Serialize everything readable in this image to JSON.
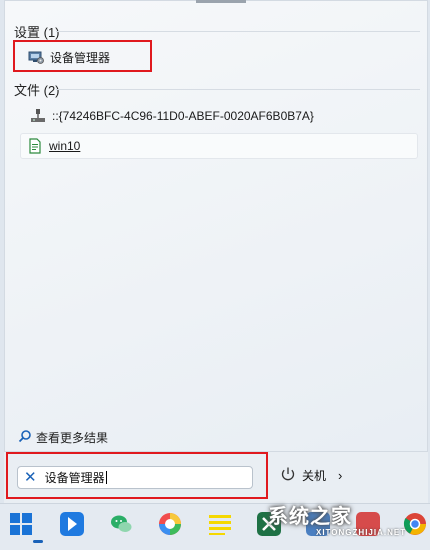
{
  "results": {
    "settings_header": "设置 (1)",
    "settings_item": "设备管理器",
    "files_header": "文件 (2)",
    "files": [
      {
        "label": "::{74246BFC-4C96-11D0-ABEF-0020AF6B0B7A}",
        "icon": "network-drive-icon"
      },
      {
        "label": "win10",
        "icon": "text-file-icon"
      }
    ],
    "see_more": "查看更多结果"
  },
  "search": {
    "value": "设备管理器",
    "clear_icon": "close-icon"
  },
  "power": {
    "label": "关机",
    "icon": "power-icon",
    "chevron_icon": "chevron-right-icon"
  },
  "highlight_color": "#e0191e",
  "accent_color": "#1a62b8",
  "taskbar": {
    "icons": [
      "windows-start-icon",
      "app-arrow-icon",
      "wechat-icon",
      "colorful-app-icon",
      "notes-icon",
      "excel-icon",
      "settings-app-icon",
      "misc-app-icon",
      "browser-icon"
    ]
  },
  "watermark": {
    "text": "系统之家",
    "sub": "XITONGZHIJIA.NET"
  }
}
